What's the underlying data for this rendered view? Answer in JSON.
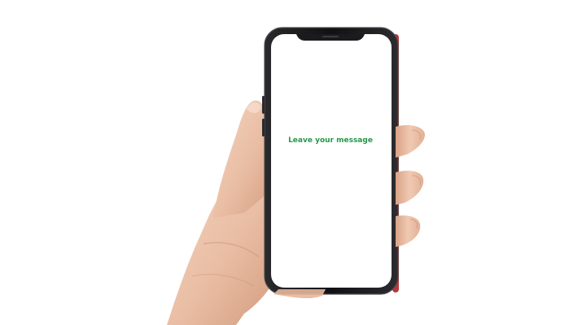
{
  "screen": {
    "message": "Leave your message"
  },
  "colors": {
    "message_text": "#27964a",
    "phone_frame": "#1b1b1d",
    "phone_edge": "#4a4a4e",
    "screen": "#ffffff",
    "skin_light": "#f1ccb6",
    "skin_mid": "#e3b195",
    "skin_shadow": "#c98e71",
    "accent_red": "#b43a3a"
  }
}
